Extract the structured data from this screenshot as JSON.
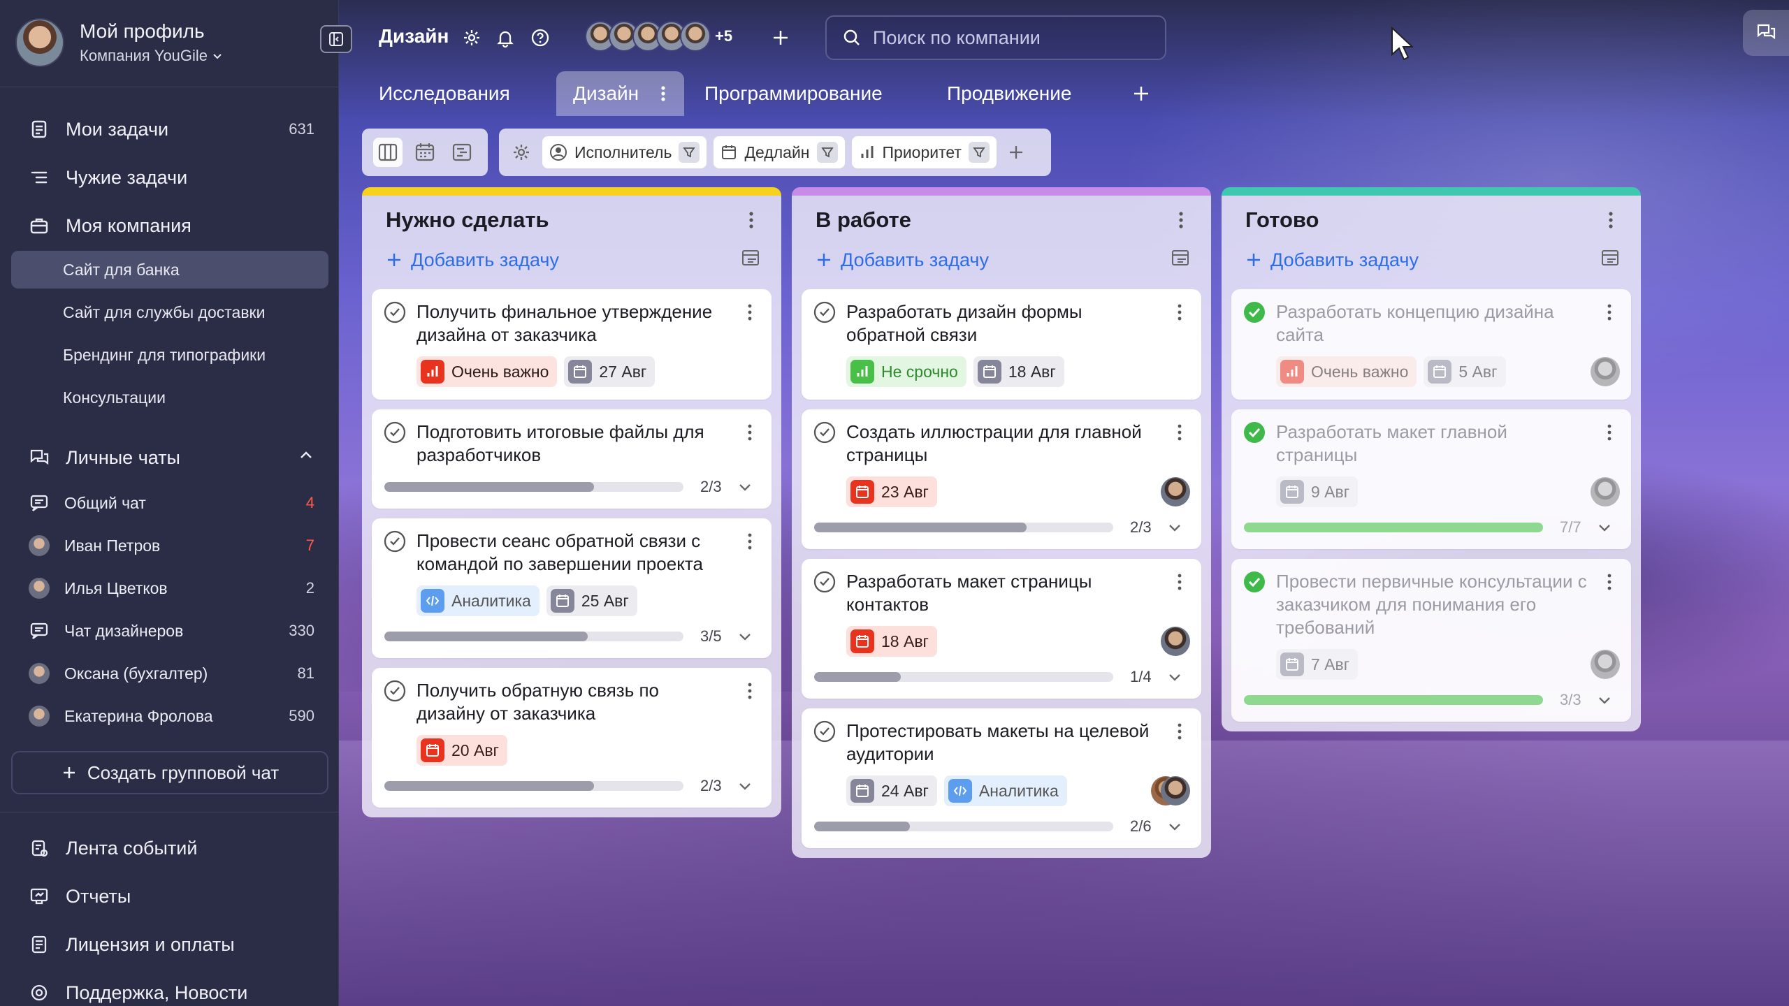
{
  "profile": {
    "name": "Мой профиль",
    "company": "Компания YouGile"
  },
  "sidebar": {
    "main_items": [
      {
        "label": "Мои задачи",
        "count": "631",
        "icon": "my-tasks-icon"
      },
      {
        "label": "Чужие задачи",
        "count": "",
        "icon": "list-icon"
      },
      {
        "label": "Моя компания",
        "count": "",
        "icon": "briefcase-icon"
      }
    ],
    "projects": [
      {
        "label": "Сайт для банка",
        "active": true
      },
      {
        "label": "Сайт для службы доставки",
        "active": false
      },
      {
        "label": "Брендинг для типографики",
        "active": false
      },
      {
        "label": "Консультации",
        "active": false
      }
    ],
    "chats_section": {
      "label": "Личные чаты"
    },
    "chats": [
      {
        "label": "Общий чат",
        "count": "4",
        "count_color": "#ff5a4a",
        "icon": "chat-icon"
      },
      {
        "label": "Иван Петров",
        "count": "7",
        "count_color": "#ff5a4a",
        "icon": "avatar"
      },
      {
        "label": "Илья Цветков",
        "count": "2",
        "count_color": "#d4d6e4",
        "icon": "avatar"
      },
      {
        "label": "Чат дизайнеров",
        "count": "330",
        "count_color": "#d4d6e4",
        "icon": "chat-icon"
      },
      {
        "label": "Оксана (бухгалтер)",
        "count": "81",
        "count_color": "#d4d6e4",
        "icon": "avatar"
      },
      {
        "label": "Екатерина Фролова",
        "count": "590",
        "count_color": "#d4d6e4",
        "icon": "avatar"
      }
    ],
    "create_group_chat": "Создать групповой чат",
    "bottom_items": [
      {
        "label": "Лента событий",
        "icon": "event-feed-icon"
      },
      {
        "label": "Отчеты",
        "icon": "reports-icon"
      },
      {
        "label": "Лицензия и оплаты",
        "icon": "license-icon"
      },
      {
        "label": "Поддержка, Новости",
        "icon": "support-icon"
      }
    ]
  },
  "topbar": {
    "board_title": "Дизайн",
    "members_more": "+5",
    "search_placeholder": "Поиск по компании"
  },
  "tabs": [
    {
      "label": "Исследования",
      "active": false
    },
    {
      "label": "Дизайн",
      "active": true
    },
    {
      "label": "Программирование",
      "active": false
    },
    {
      "label": "Продвижение",
      "active": false
    }
  ],
  "filters": [
    {
      "label": "Исполнитель",
      "icon": "user-icon"
    },
    {
      "label": "Дедлайн",
      "icon": "calendar-icon"
    },
    {
      "label": "Приоритет",
      "icon": "priority-icon"
    }
  ],
  "add_task_label": "Добавить задачу",
  "columns": [
    {
      "title": "Нужно сделать",
      "stripe": "#f6d21c",
      "cards": [
        {
          "title": "Получить финальное утверждение дизайна от заказчика",
          "tags": [
            {
              "type": "urgent",
              "label": "Очень важно"
            },
            {
              "type": "date",
              "label": "27 Авг"
            }
          ]
        },
        {
          "title": "Подготовить итоговые файлы для разработчиков",
          "tags": [],
          "progress": {
            "text": "2/3",
            "fraction": 0.7
          }
        },
        {
          "title": "Провести сеанс обратной связи с командой по завершении проекта",
          "tags": [
            {
              "type": "analytic",
              "label": "Аналитика"
            },
            {
              "type": "date",
              "label": "25 Авг"
            }
          ],
          "progress": {
            "text": "3/5",
            "fraction": 0.68
          }
        },
        {
          "title": "Получить обратную связь по дизайну от заказчика",
          "tags": [
            {
              "type": "overdue",
              "label": "20 Авг"
            }
          ],
          "progress": {
            "text": "2/3",
            "fraction": 0.7
          }
        }
      ]
    },
    {
      "title": "В работе",
      "stripe": "#c88ce8",
      "cards": [
        {
          "title": "Разработать дизайн формы обратной связи",
          "tags": [
            {
              "type": "notur",
              "label": "Не срочно"
            },
            {
              "type": "date",
              "label": "18 Авг"
            }
          ]
        },
        {
          "title": "Создать иллюстрации для главной страницы",
          "tags": [
            {
              "type": "overdue",
              "label": "23 Авг"
            }
          ],
          "avatar": 1,
          "progress": {
            "text": "2/3",
            "fraction": 0.71
          }
        },
        {
          "title": "Разработать макет страницы контактов",
          "tags": [
            {
              "type": "overdue",
              "label": "18 Авг"
            }
          ],
          "avatar": 1,
          "progress": {
            "text": "1/4",
            "fraction": 0.29
          }
        },
        {
          "title": "Протестировать макеты на целевой аудитории",
          "tags": [
            {
              "type": "date",
              "label": "24 Авг"
            },
            {
              "type": "analytic",
              "label": "Аналитика"
            }
          ],
          "avatar": 2,
          "progress": {
            "text": "2/6",
            "fraction": 0.32
          }
        }
      ]
    },
    {
      "title": "Готово",
      "stripe": "#3fc8b0",
      "cards": [
        {
          "title": "Разработать концепцию дизайна сайта",
          "done": true,
          "tags": [
            {
              "type": "urgent",
              "label": "Очень важно"
            },
            {
              "type": "date",
              "label": "5 Авг"
            }
          ],
          "avatar": 1
        },
        {
          "title": "Разработать макет главной страницы",
          "done": true,
          "tags": [
            {
              "type": "date",
              "label": "9 Авг"
            }
          ],
          "avatar": 1,
          "progress": {
            "text": "7/7",
            "fraction": 1.0,
            "green": true
          }
        },
        {
          "title": "Провести первичные консультации с заказчиком для понимания его требований",
          "done": true,
          "tags": [
            {
              "type": "date",
              "label": "7 Авг"
            }
          ],
          "avatar": 1,
          "progress": {
            "text": "3/3",
            "fraction": 1.0,
            "green": true
          }
        }
      ]
    }
  ]
}
